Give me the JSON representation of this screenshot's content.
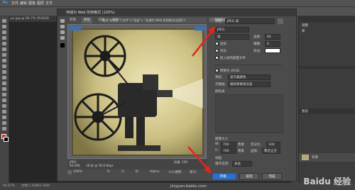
{
  "app": {
    "menu": [
      "文件",
      "编辑",
      "图像",
      "图层",
      "文字",
      "选择",
      "滤镜",
      "3D",
      "视图",
      "窗口",
      "帮助"
    ],
    "doc_tab": "ps.jpg @ 66.7% (RGB/8)",
    "status_left": "66.67%",
    "status_doc": "文档:1.92M/1.92M"
  },
  "dialog": {
    "title": "存储为 Web 所用格式 (100%)",
    "hint": "使用\"存储为\"(\"文件\">\"导出\"> \"存储为 Web 所用格式(旧版)\")",
    "hint_close": "不再显示",
    "view_tabs": [
      "原稿",
      "优化",
      "双联",
      "四联"
    ],
    "active_view": "优化",
    "preview_caption_1": "JPEG",
    "preview_caption_2": "94.06K",
    "preview_caption_3": "18 秒 @ 56.6 Kbps",
    "preview_right": "质量: 100",
    "zoom": "100%",
    "r_label": "R:",
    "g_label": "G:",
    "b_label": "B:",
    "alpha_label": "Alpha:",
    "hex_label": "十六进制:",
    "index_label": "索引:"
  },
  "settings": {
    "preset_label": "预设:",
    "preset_value": "JPEG 高",
    "format_value": "JPEG",
    "quality_label": "品质:",
    "quality_value": "高",
    "quality_num_label": "品质:",
    "quality_num": "60",
    "progressive_label": "连续",
    "blur_label": "模糊:",
    "blur_value": "0",
    "optimized_label": "优化",
    "matte_label": "杂边:",
    "embed_profile_label": "嵌入颜色配置文件",
    "convert_srgb_label": "转换为 sRGB",
    "preview_label": "预览:",
    "preview_value": "显示器颜色",
    "metadata_label": "元数据:",
    "metadata_value": "版权和联系信息",
    "color_table_label": "颜色表",
    "image_size_label": "图像大小",
    "w_label": "W:",
    "w_value": "700",
    "h_label": "H:",
    "h_value": "700",
    "px_unit": "像素",
    "percent_label": "百分比:",
    "percent_value": "100",
    "quality2_label": "品质:",
    "quality2_value": "两次立方",
    "anim_label": "动画",
    "loop_label": "循环选项:",
    "loop_value": "永远",
    "save_button": "存储...",
    "cancel_button": "取消",
    "done_button": "完成"
  },
  "panels": {
    "layers_title": "图层",
    "layer_name": "背景",
    "adjust_label": "调整",
    "lib_label": "库"
  },
  "watermark": {
    "brand": "Baidu 经验",
    "url": "jingyan.baidu.com"
  },
  "colors": {
    "accent_red": "#e8231c",
    "primary_blue": "#2f6ecb"
  }
}
